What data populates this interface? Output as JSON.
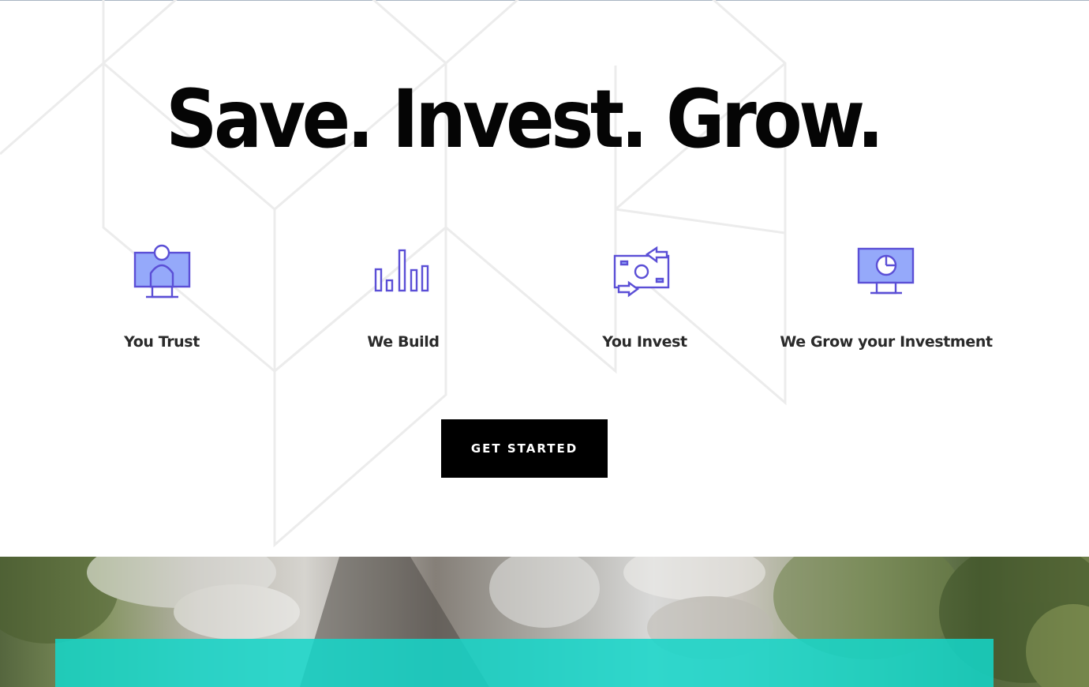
{
  "hero": {
    "title": "Save. Invest. Grow."
  },
  "features": [
    {
      "label": "You Trust",
      "icon": "person-monitor-icon"
    },
    {
      "label": "We Build",
      "icon": "bar-chart-icon"
    },
    {
      "label": "You Invest",
      "icon": "money-exchange-icon"
    },
    {
      "label": "We Grow your Investment",
      "icon": "pie-chart-monitor-icon"
    }
  ],
  "cta": {
    "label": "GET STARTED"
  },
  "colors": {
    "icon_stroke": "#5b4fd6",
    "icon_fill": "#95a9fa",
    "button_bg": "#000000",
    "teal_accent": "#14d6ca"
  }
}
